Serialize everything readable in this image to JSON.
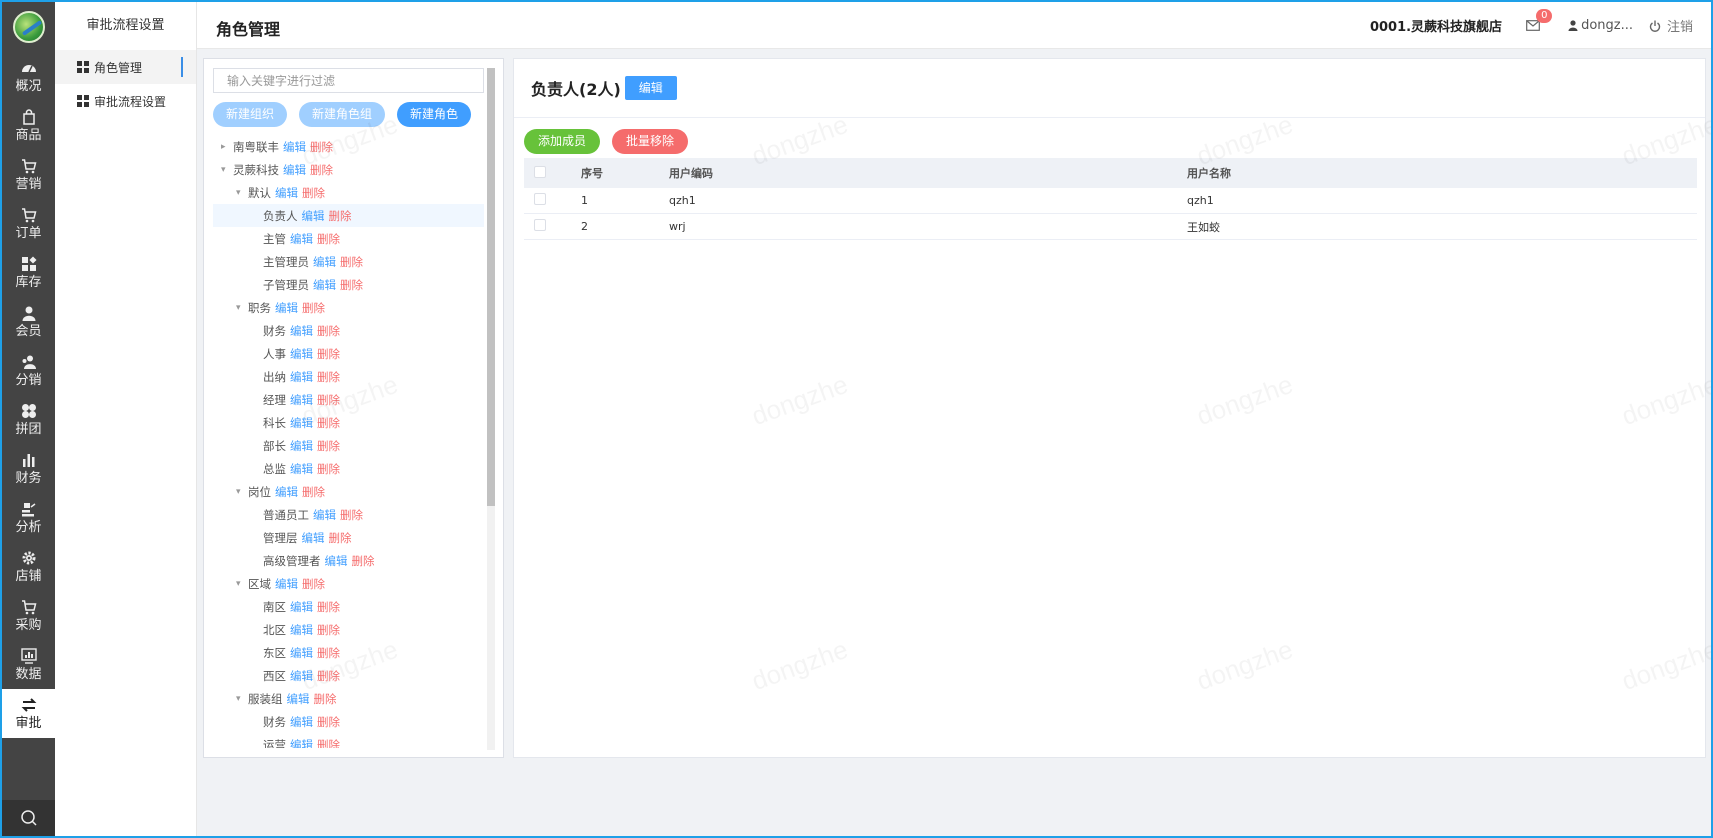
{
  "nav": {
    "items": [
      {
        "label": "概况",
        "icon": "dashboard-icon"
      },
      {
        "label": "商品",
        "icon": "bag-icon"
      },
      {
        "label": "营销",
        "icon": "cart-icon"
      },
      {
        "label": "订单",
        "icon": "cart-icon"
      },
      {
        "label": "库存",
        "icon": "grid-icon"
      },
      {
        "label": "会员",
        "icon": "user-icon"
      },
      {
        "label": "分销",
        "icon": "users-icon"
      },
      {
        "label": "拼团",
        "icon": "group-icon"
      },
      {
        "label": "财务",
        "icon": "bars-icon"
      },
      {
        "label": "分析",
        "icon": "analysis-icon"
      },
      {
        "label": "店铺",
        "icon": "gear-icon"
      },
      {
        "label": "采购",
        "icon": "cart-icon"
      },
      {
        "label": "数据",
        "icon": "chart-icon"
      },
      {
        "label": "审批",
        "icon": "swap-icon"
      }
    ]
  },
  "subnav": {
    "title": "审批流程设置",
    "items": [
      {
        "label": "角色管理"
      },
      {
        "label": "审批流程设置"
      }
    ]
  },
  "header": {
    "title": "角色管理",
    "shop": "0001.灵蕨科技旗舰店",
    "mail_count": "0",
    "user": "dongz...",
    "logout": "注销"
  },
  "tree_panel": {
    "filter_placeholder": "输入关键字进行过滤",
    "buttons": {
      "new_org": "新建组织",
      "new_group": "新建角色组",
      "new_role": "新建角色"
    },
    "edit_label": "编辑",
    "delete_label": "删除",
    "nodes": [
      {
        "label": "南粤联丰",
        "level": 0,
        "caret": "▸"
      },
      {
        "label": "灵蕨科技",
        "level": 0,
        "caret": "▾"
      },
      {
        "label": "默认",
        "level": 1,
        "caret": "▾"
      },
      {
        "label": "负责人",
        "level": 2,
        "caret": ""
      },
      {
        "label": "主管",
        "level": 2,
        "caret": ""
      },
      {
        "label": "主管理员",
        "level": 2,
        "caret": ""
      },
      {
        "label": "子管理员",
        "level": 2,
        "caret": ""
      },
      {
        "label": "职务",
        "level": 1,
        "caret": "▾"
      },
      {
        "label": "财务",
        "level": 2,
        "caret": ""
      },
      {
        "label": "人事",
        "level": 2,
        "caret": ""
      },
      {
        "label": "出纳",
        "level": 2,
        "caret": ""
      },
      {
        "label": "经理",
        "level": 2,
        "caret": ""
      },
      {
        "label": "科长",
        "level": 2,
        "caret": ""
      },
      {
        "label": "部长",
        "level": 2,
        "caret": ""
      },
      {
        "label": "总监",
        "level": 2,
        "caret": ""
      },
      {
        "label": "岗位",
        "level": 1,
        "caret": "▾"
      },
      {
        "label": "普通员工",
        "level": 2,
        "caret": ""
      },
      {
        "label": "管理层",
        "level": 2,
        "caret": ""
      },
      {
        "label": "高级管理者",
        "level": 2,
        "caret": ""
      },
      {
        "label": "区域",
        "level": 1,
        "caret": "▾"
      },
      {
        "label": "南区",
        "level": 2,
        "caret": ""
      },
      {
        "label": "北区",
        "level": 2,
        "caret": ""
      },
      {
        "label": "东区",
        "level": 2,
        "caret": ""
      },
      {
        "label": "西区",
        "level": 2,
        "caret": ""
      },
      {
        "label": "服装组",
        "level": 1,
        "caret": "▾"
      },
      {
        "label": "财务",
        "level": 2,
        "caret": ""
      },
      {
        "label": "运营",
        "level": 2,
        "caret": ""
      }
    ]
  },
  "main_panel": {
    "title": "负责人(2人)",
    "edit_button": "编辑",
    "add_member": "添加成员",
    "batch_remove": "批量移除",
    "columns": {
      "idx": "序号",
      "code": "用户编码",
      "name": "用户名称"
    },
    "rows": [
      {
        "idx": "1",
        "code": "qzh1",
        "name": "qzh1"
      },
      {
        "idx": "2",
        "code": "wrj",
        "name": "王如蛟"
      }
    ]
  },
  "watermark": "dongzhe",
  "colors": {
    "primary": "#409eff",
    "success": "#67c23a",
    "danger": "#f56c6c",
    "sidebar": "#444444",
    "frame": "#1ea0e8"
  }
}
